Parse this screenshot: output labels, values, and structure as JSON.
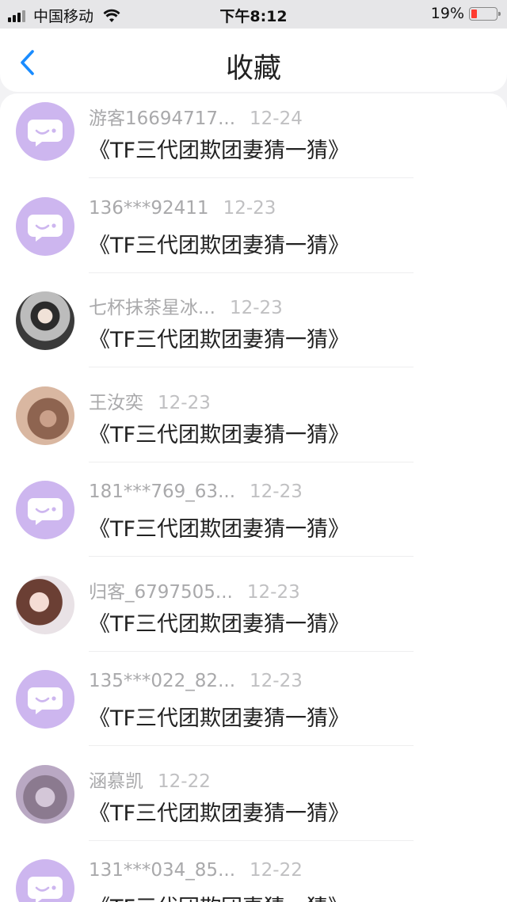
{
  "status": {
    "carrier": "中国移动",
    "time": "下午8:12",
    "battery": "19%",
    "battery_level": 0.19,
    "battery_color": "#ff3b30"
  },
  "header": {
    "title": "收藏"
  },
  "items": [
    {
      "avatar": "default-chat-avatar",
      "name": "游客16694717...",
      "date": "12-24",
      "post": "《TF三代团欺团妻猜一猜》"
    },
    {
      "avatar": "default-chat-avatar",
      "name": "136***92411",
      "date": "12-23",
      "post": "《TF三代团欺团妻猜一猜》"
    },
    {
      "avatar": "photo-avatar",
      "name": "七杯抹茶星冰...",
      "date": "12-23",
      "post": "《TF三代团欺团妻猜一猜》"
    },
    {
      "avatar": "photo-avatar",
      "name": "王汝奕",
      "date": "12-23",
      "post": "《TF三代团欺团妻猜一猜》"
    },
    {
      "avatar": "default-chat-avatar",
      "name": "181***769_63...",
      "date": "12-23",
      "post": "《TF三代团欺团妻猜一猜》"
    },
    {
      "avatar": "photo-avatar",
      "name": "归客_6797505...",
      "date": "12-23",
      "post": "《TF三代团欺团妻猜一猜》"
    },
    {
      "avatar": "default-chat-avatar",
      "name": "135***022_82...",
      "date": "12-23",
      "post": "《TF三代团欺团妻猜一猜》"
    },
    {
      "avatar": "photo-avatar",
      "name": "涵慕凯",
      "date": "12-22",
      "post": "《TF三代团欺团妻猜一猜》"
    },
    {
      "avatar": "default-chat-avatar",
      "name": "131***034_85...",
      "date": "12-22",
      "post": "《TF三代团欺团妻猜一猜》"
    }
  ],
  "colors": {
    "accent": "#1a8cff",
    "default_avatar": "#cdb6ef"
  }
}
